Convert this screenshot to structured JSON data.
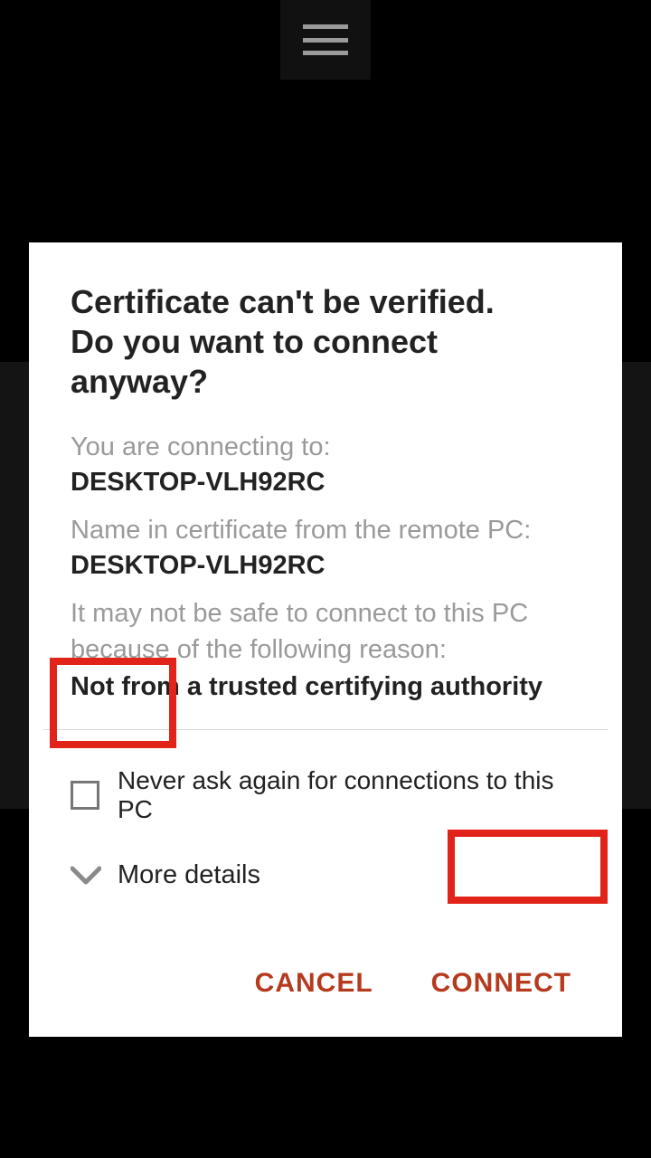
{
  "dialog": {
    "title_line1": "Certificate can't be verified.",
    "title_line2": "Do you want to connect anyway?",
    "connecting_to_label": "You are connecting to:",
    "connecting_to_value": "DESKTOP-VLH92RC",
    "cert_name_label": "Name in certificate from the remote PC:",
    "cert_name_value": "DESKTOP-VLH92RC",
    "reason_label_line1": "It may not be safe to connect to this PC",
    "reason_label_line2": "because of the following reason:",
    "reason_value": "Not from a trusted certifying authority",
    "never_ask_label": "Never ask again for connections to this PC",
    "never_ask_checked": false,
    "more_details_label": "More details",
    "cancel_label": "CANCEL",
    "connect_label": "CONNECT"
  },
  "icons": {
    "menu": "hamburger-icon",
    "chevron_down": "chevron-down-icon"
  },
  "colors": {
    "accent": "#b53a1e",
    "highlight": "#e2231a"
  }
}
